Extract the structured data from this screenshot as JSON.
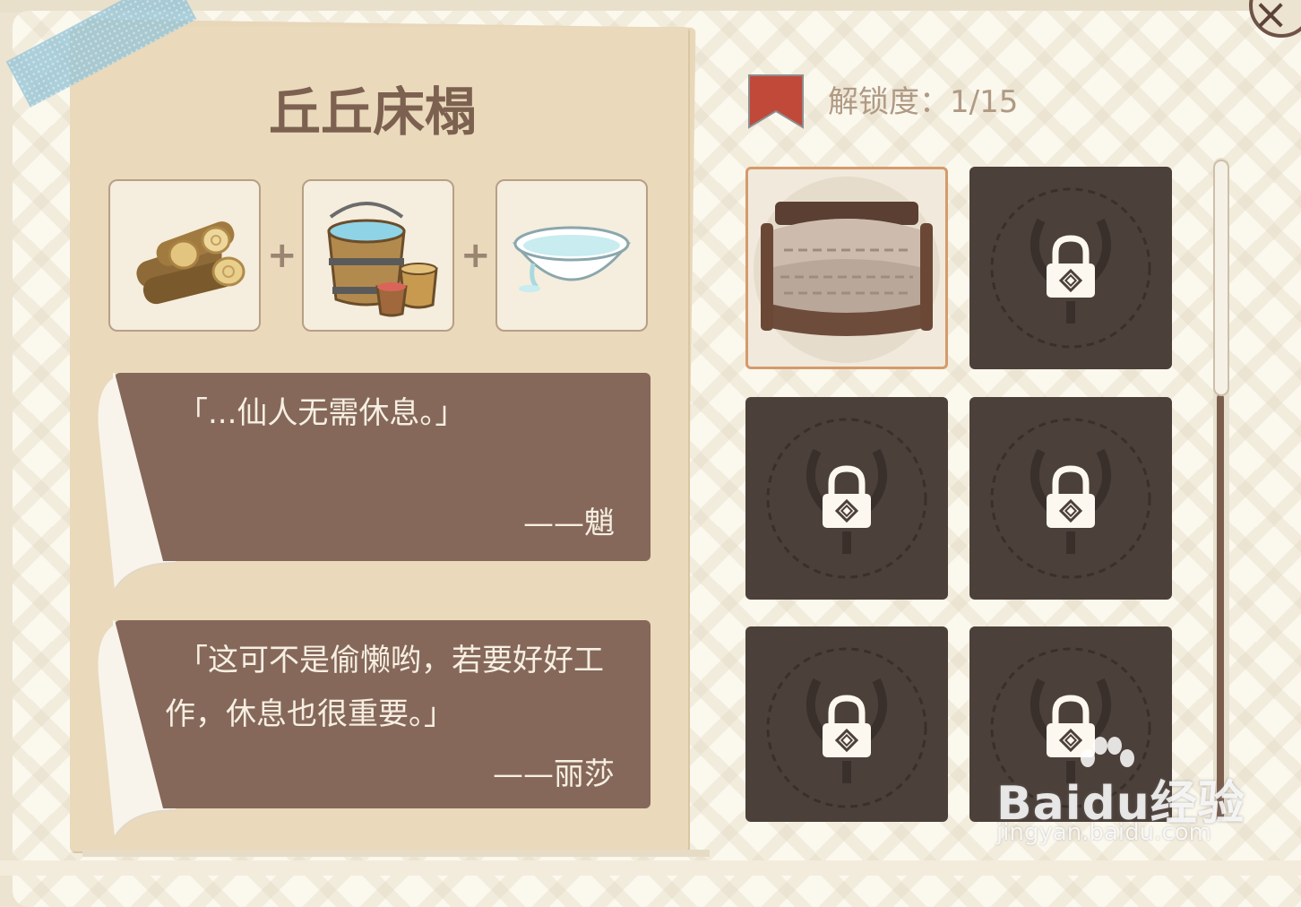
{
  "item": {
    "title": "丘丘床榻",
    "ingredients": [
      {
        "icon": "firewood-icon"
      },
      {
        "icon": "wooden-bucket-icon"
      },
      {
        "icon": "water-bowl-icon"
      }
    ],
    "plus_sign": "+"
  },
  "quotes": [
    {
      "text_lines": [
        "「...仙人无需休息。」"
      ],
      "author": "——魈"
    },
    {
      "text_lines": [
        "「这可不是偷懒哟，若要好好工",
        "作，休息也很重要。」"
      ],
      "author": "——丽莎"
    }
  ],
  "collection": {
    "unlock_label": "解锁度：1/15",
    "unlocked_count": 1,
    "total_count": 15,
    "tiles": [
      {
        "state": "unlocked",
        "icon": "hilichurl-bed-icon"
      },
      {
        "state": "locked",
        "icon": "lock-icon"
      },
      {
        "state": "locked",
        "icon": "lock-icon"
      },
      {
        "state": "locked",
        "icon": "lock-icon"
      },
      {
        "state": "locked",
        "icon": "lock-icon"
      },
      {
        "state": "locked",
        "icon": "lock-icon"
      }
    ]
  },
  "close_icon": "×",
  "watermark": {
    "brand": "Baidu经验",
    "url": "jingyan.baidu.com"
  },
  "colors": {
    "accent": "#c0493a",
    "card": "#85685a",
    "locked_tile": "#4c403a",
    "unlocked_border": "#d59a6b"
  }
}
